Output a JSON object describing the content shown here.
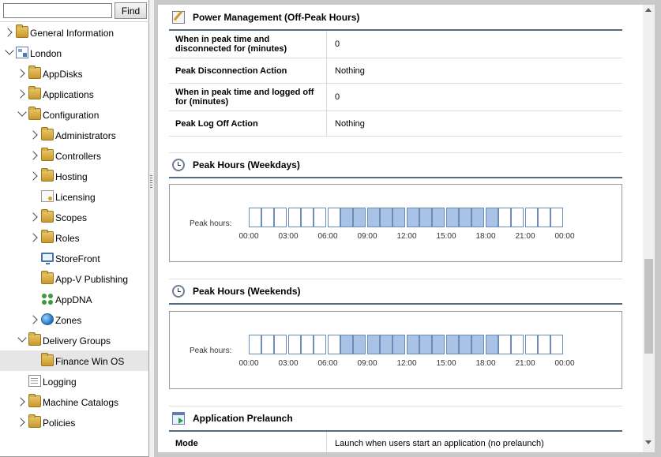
{
  "search": {
    "placeholder": "",
    "value": "",
    "find_label": "Find"
  },
  "tree": [
    {
      "id": "general-information",
      "label": "General Information",
      "icon": "folder-icon",
      "arrow": "right",
      "depth": 0
    },
    {
      "id": "london",
      "label": "London",
      "icon": "site-icon",
      "arrow": "down",
      "depth": 0
    },
    {
      "id": "appdisks",
      "label": "AppDisks",
      "icon": "appdisks-icon",
      "arrow": "right",
      "depth": 1
    },
    {
      "id": "applications",
      "label": "Applications",
      "icon": "applications-icon",
      "arrow": "right",
      "depth": 1
    },
    {
      "id": "configuration",
      "label": "Configuration",
      "icon": "configuration-icon",
      "arrow": "down",
      "depth": 1
    },
    {
      "id": "administrators",
      "label": "Administrators",
      "icon": "administrators-icon",
      "arrow": "right",
      "depth": 2
    },
    {
      "id": "controllers",
      "label": "Controllers",
      "icon": "controllers-icon",
      "arrow": "right",
      "depth": 2
    },
    {
      "id": "hosting",
      "label": "Hosting",
      "icon": "hosting-icon",
      "arrow": "right",
      "depth": 2
    },
    {
      "id": "licensing",
      "label": "Licensing",
      "icon": "licensing-icon",
      "arrow": "",
      "depth": 2
    },
    {
      "id": "scopes",
      "label": "Scopes",
      "icon": "scopes-icon",
      "arrow": "right",
      "depth": 2
    },
    {
      "id": "roles",
      "label": "Roles",
      "icon": "roles-icon",
      "arrow": "right",
      "depth": 2
    },
    {
      "id": "storefront",
      "label": "StoreFront",
      "icon": "storefront-icon",
      "arrow": "",
      "depth": 2
    },
    {
      "id": "appv-publishing",
      "label": "App-V Publishing",
      "icon": "appv-icon",
      "arrow": "",
      "depth": 2
    },
    {
      "id": "appdna",
      "label": "AppDNA",
      "icon": "appdna-icon",
      "arrow": "",
      "depth": 2
    },
    {
      "id": "zones",
      "label": "Zones",
      "icon": "zones-icon",
      "arrow": "right",
      "depth": 2
    },
    {
      "id": "delivery-groups",
      "label": "Delivery Groups",
      "icon": "delivery-groups-icon",
      "arrow": "down",
      "depth": 1
    },
    {
      "id": "finance-win-os",
      "label": "Finance Win OS",
      "icon": "delivery-group-icon",
      "arrow": "",
      "depth": 2,
      "selected": true
    },
    {
      "id": "logging",
      "label": "Logging",
      "icon": "logging-icon",
      "arrow": "",
      "depth": 1
    },
    {
      "id": "machine-catalogs",
      "label": "Machine Catalogs",
      "icon": "machine-catalogs-icon",
      "arrow": "right",
      "depth": 1
    },
    {
      "id": "policies",
      "label": "Policies",
      "icon": "policies-icon",
      "arrow": "right",
      "depth": 1
    }
  ],
  "power_management": {
    "title": "Power Management (Off-Peak Hours)",
    "icon": "power-management-icon",
    "rows": [
      {
        "label": "When in peak time and disconnected for (minutes)",
        "value": "0"
      },
      {
        "label": "Peak Disconnection Action",
        "value": "Nothing"
      },
      {
        "label": "When in peak time and logged off for (minutes)",
        "value": "0"
      },
      {
        "label": "Peak Log Off Action",
        "value": "Nothing"
      }
    ]
  },
  "peak_weekdays": {
    "title": "Peak Hours (Weekdays)",
    "icon": "clock-icon",
    "label": "Peak hours:",
    "hours": [
      0,
      0,
      0,
      0,
      0,
      0,
      0,
      1,
      1,
      1,
      1,
      1,
      1,
      1,
      1,
      1,
      1,
      1,
      1,
      0,
      0,
      0,
      0,
      0
    ],
    "tick_labels": [
      "00:00",
      "03:00",
      "06:00",
      "09:00",
      "12:00",
      "15:00",
      "18:00",
      "21:00",
      "00:00"
    ]
  },
  "peak_weekends": {
    "title": "Peak Hours (Weekends)",
    "icon": "clock-icon",
    "label": "Peak hours:",
    "hours": [
      0,
      0,
      0,
      0,
      0,
      0,
      0,
      1,
      1,
      1,
      1,
      1,
      1,
      1,
      1,
      1,
      1,
      1,
      1,
      0,
      0,
      0,
      0,
      0
    ],
    "tick_labels": [
      "00:00",
      "03:00",
      "06:00",
      "09:00",
      "12:00",
      "15:00",
      "18:00",
      "21:00",
      "00:00"
    ]
  },
  "application_prelaunch": {
    "title": "Application Prelaunch",
    "icon": "prelaunch-icon",
    "rows": [
      {
        "label": "Mode",
        "value": "Launch when users start an application (no prelaunch)"
      }
    ]
  }
}
